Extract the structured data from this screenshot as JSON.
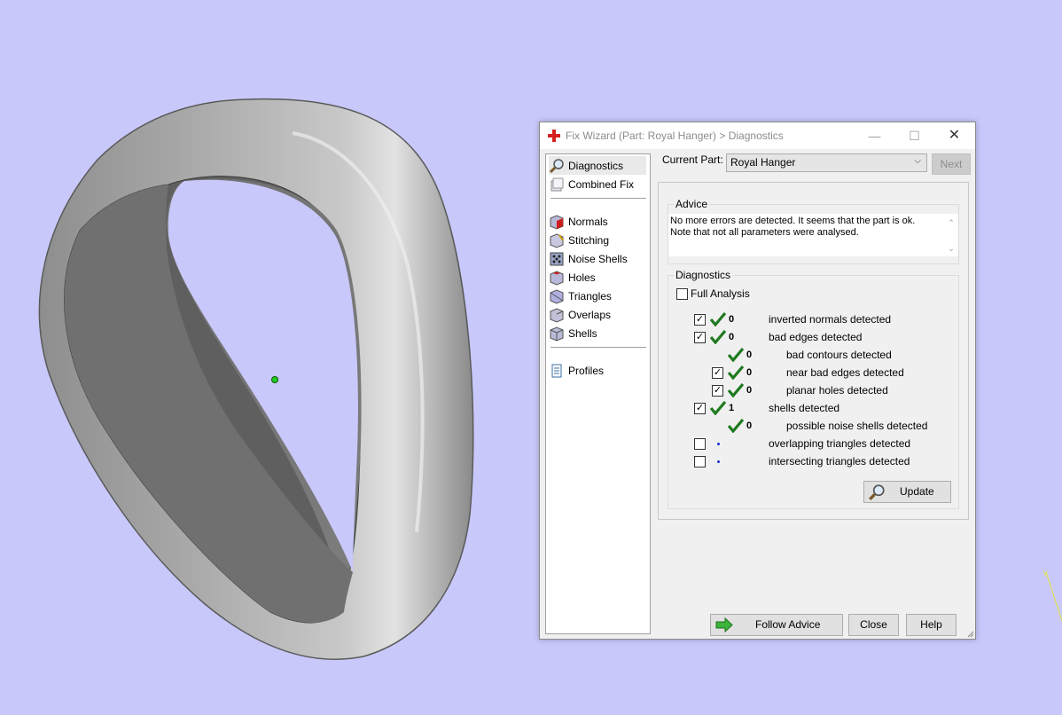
{
  "window": {
    "title": "Fix Wizard (Part: Royal Hanger) > Diagnostics",
    "minimize_glyph": "—",
    "maximize_glyph": "☐",
    "close_glyph": "✕"
  },
  "nav": {
    "items": [
      {
        "label": "Diagnostics",
        "icon": "magnifier-icon",
        "active": true
      },
      {
        "label": "Combined Fix",
        "icon": "combined-fix-icon"
      },
      {
        "label": "Normals",
        "icon": "normals-cube-icon"
      },
      {
        "label": "Stitching",
        "icon": "stitching-cube-icon"
      },
      {
        "label": "Noise Shells",
        "icon": "noise-shells-icon"
      },
      {
        "label": "Holes",
        "icon": "holes-cube-icon"
      },
      {
        "label": "Triangles",
        "icon": "triangles-cube-icon"
      },
      {
        "label": "Overlaps",
        "icon": "overlaps-cube-icon"
      },
      {
        "label": "Shells",
        "icon": "shells-cube-icon"
      },
      {
        "label": "Profiles",
        "icon": "document-icon"
      }
    ]
  },
  "part": {
    "label": "Current Part:",
    "value": "Royal Hanger",
    "next_label": "Next"
  },
  "advice": {
    "title": "Advice",
    "line1": "No more errors are detected. It seems that the part is ok.",
    "line2": "Note that not all parameters were analysed."
  },
  "diagnostics": {
    "title": "Diagnostics",
    "full_analysis": "Full Analysis",
    "rows": [
      {
        "count": "0",
        "label": "inverted normals detected",
        "checked": true,
        "status": "ok"
      },
      {
        "count": "0",
        "label": "bad edges detected",
        "checked": true,
        "status": "ok"
      },
      {
        "count": "0",
        "label": "bad contours detected",
        "status": "ok"
      },
      {
        "count": "0",
        "label": "near bad edges detected",
        "checked": true,
        "status": "ok"
      },
      {
        "count": "0",
        "label": "planar holes detected",
        "checked": true,
        "status": "ok"
      },
      {
        "count": "1",
        "label": "shells detected",
        "checked": true,
        "status": "ok"
      },
      {
        "count": "0",
        "label": "possible noise shells detected",
        "status": "ok"
      },
      {
        "count": "",
        "label": "overlapping triangles detected",
        "checked": false,
        "status": "not-analysed"
      },
      {
        "count": "",
        "label": "intersecting triangles detected",
        "checked": false,
        "status": "not-analysed"
      }
    ],
    "update_label": "Update"
  },
  "footer": {
    "follow_advice": "Follow Advice",
    "close": "Close",
    "help": "Help"
  },
  "colors": {
    "background": "#c8c8fa",
    "ok_check": "#1f7a1f",
    "follow_arrow": "#3cb43c",
    "title_icon": "#d42020"
  }
}
